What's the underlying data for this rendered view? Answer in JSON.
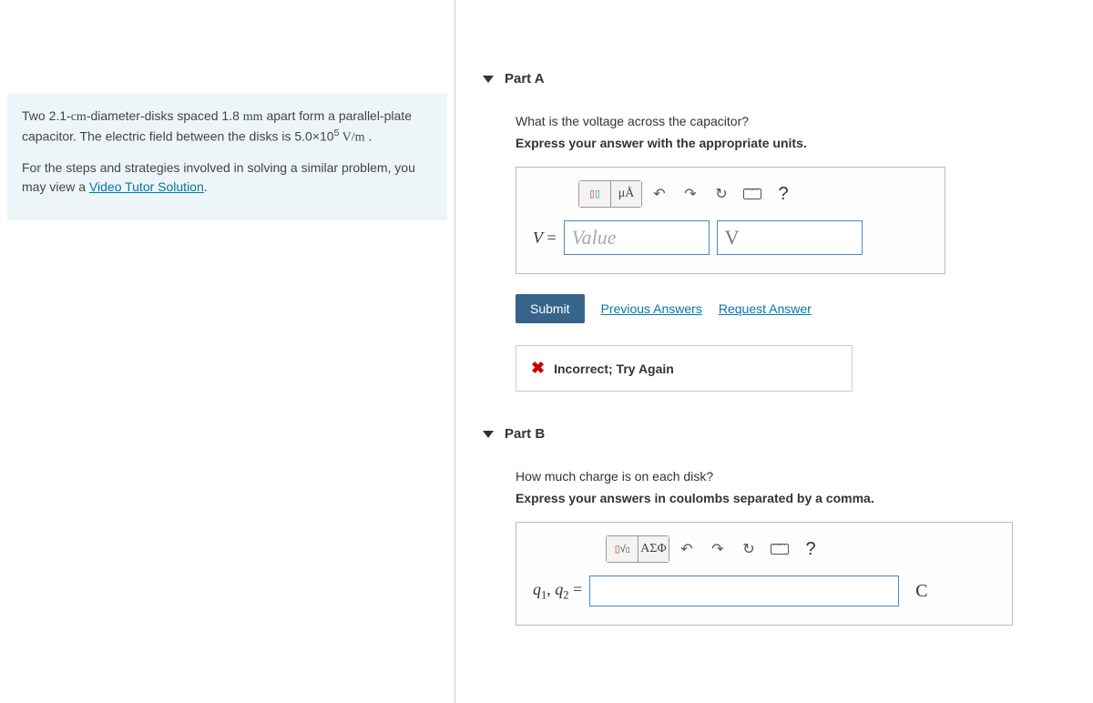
{
  "problem": {
    "line1_pre": "Two 2.1-",
    "line1_unit1": "cm",
    "line1_mid": "-diameter-disks spaced 1.8 ",
    "line1_unit2": "mm",
    "line1_post": " apart form a parallel-plate capacitor. The electric field between the disks is 5.0×10",
    "line1_exp": "5",
    "line1_unit3": " V/m",
    "line1_end": " .",
    "line2_pre": "For the steps and strategies involved in solving a similar problem, you may view a ",
    "line2_link": "Video Tutor Solution",
    "line2_post": "."
  },
  "partA": {
    "title": "Part A",
    "question": "What is the voltage across the capacitor?",
    "instruction": "Express your answer with the appropriate units.",
    "toolbar": {
      "units": "μÅ"
    },
    "var": "V",
    "eq": " = ",
    "value_ph": "Value",
    "unit_text": "V",
    "submit": "Submit",
    "prev": "Previous Answers",
    "request": "Request Answer",
    "feedback": "Incorrect; Try Again"
  },
  "partB": {
    "title": "Part B",
    "question": "How much charge is on each disk?",
    "instruction": "Express your answers in coulombs separated by a comma.",
    "toolbar": {
      "greek": "ΑΣΦ"
    },
    "var1": "q",
    "sub1": "1",
    "comma": ", ",
    "var2": "q",
    "sub2": "2",
    "eq": " = ",
    "unit": "C"
  }
}
